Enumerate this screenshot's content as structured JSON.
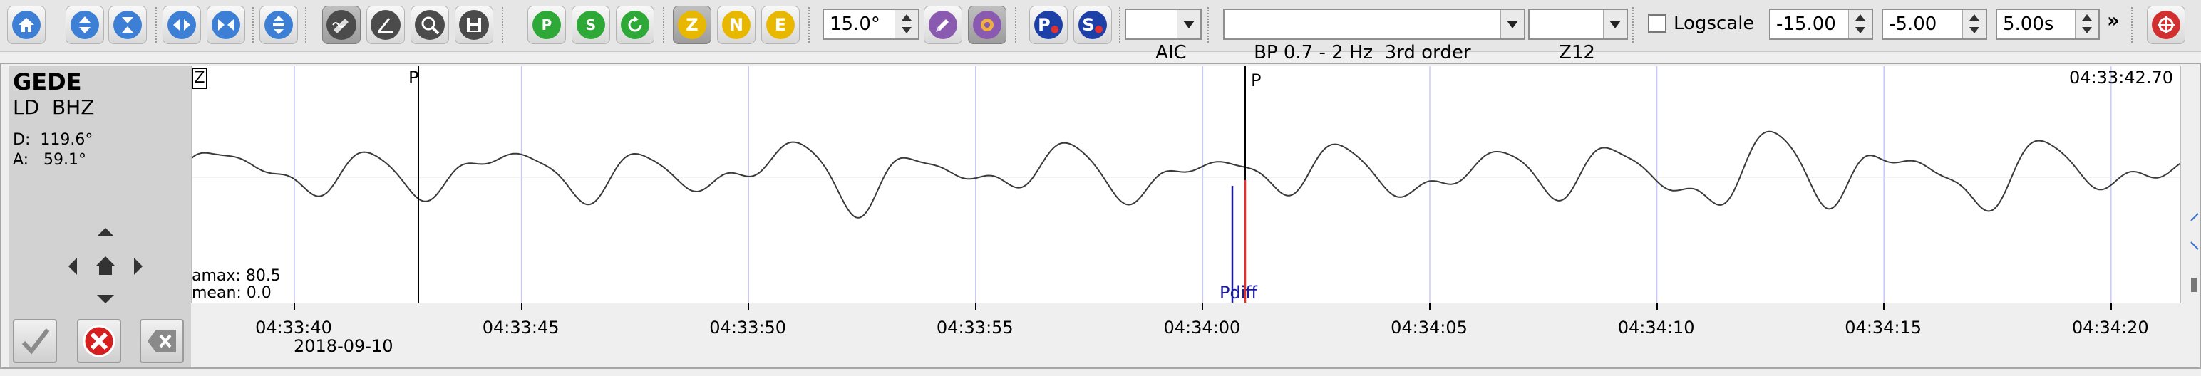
{
  "toolbar": {
    "pick_phase_1": "P",
    "pick_phase_2": "S",
    "comp_z": "Z",
    "comp_n": "N",
    "comp_e": "E",
    "mark_p": "P",
    "mark_s": "S",
    "angle_value": "15.0°",
    "picker_method": "AIC",
    "filter": "BP 0.7 - 2 Hz  3rd order",
    "rotation": "Z12",
    "logscale_label": "Logscale",
    "logscale_checked": false,
    "min_value": "-15.00",
    "max_value": "-5.00",
    "time_window": "5.00s",
    "overflow": "»"
  },
  "info": {
    "station": "GEDE",
    "channel": "LD  BHZ",
    "distance": "D:  119.6°",
    "azimuth": "A:   59.1°"
  },
  "trace": {
    "component_label": "Z",
    "pick_p_left": "P",
    "pick_p_main": "P",
    "theoretical_phase": "Pdiff",
    "end_time": "04:33:42.70",
    "amax": "amax: 80.5",
    "mean": "mean: 0.0"
  },
  "axis": {
    "ticks": [
      "04:33:40",
      "04:33:45",
      "04:33:50",
      "04:33:55",
      "04:34:00",
      "04:34:05",
      "04:34:10",
      "04:34:15",
      "04:34:20"
    ],
    "date": "2018-09-10"
  },
  "colors": {
    "trace": "#3a3a3a",
    "grid": "#c8c8ff",
    "pdiff": "#1a1aa0",
    "pick_red": "#e03030",
    "z_icon": "#e8b800",
    "p_icon": "#1c3fa8",
    "s_icon": "#d02a2a",
    "green_icon": "#2ea836",
    "purple_icon": "#8a5ab0"
  }
}
